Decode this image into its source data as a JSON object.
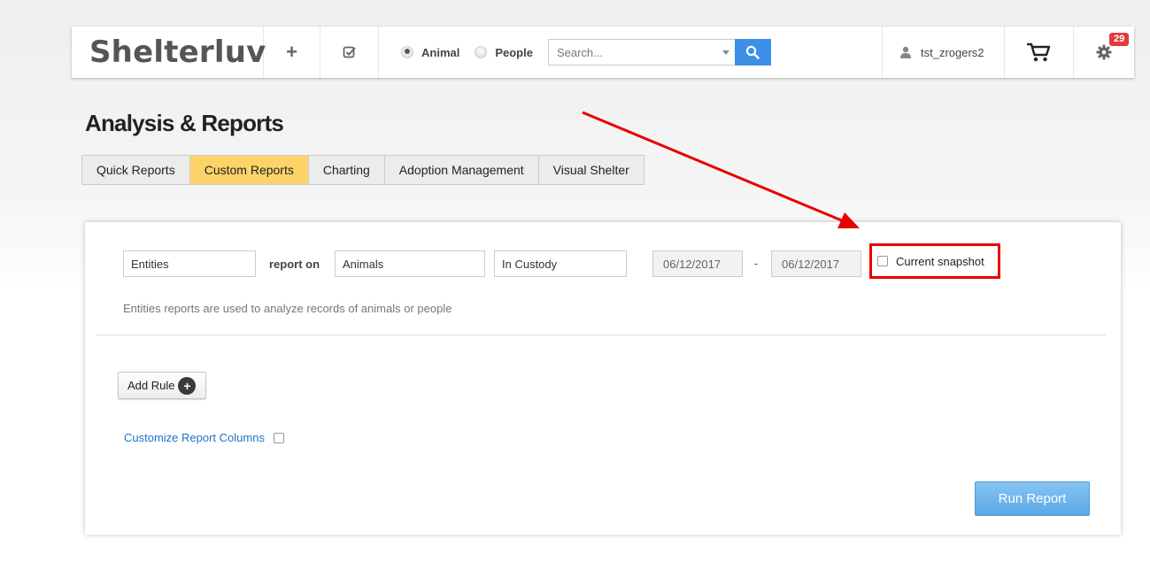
{
  "navbar": {
    "brand": "Shelterluv",
    "add_icon": "plus-icon",
    "tasks_icon": "checkbox-icon",
    "radio_options": [
      {
        "label": "Animal",
        "checked": true
      },
      {
        "label": "People",
        "checked": false
      }
    ],
    "search_placeholder": "Search...",
    "search_icon": "search-icon",
    "username": "tst_zrogers2",
    "cart_icon": "cart-icon",
    "settings_icon": "gear-icon",
    "notification_count": "29"
  },
  "page": {
    "title": "Analysis & Reports",
    "tabs": [
      {
        "label": "Quick Reports",
        "active": false
      },
      {
        "label": "Custom Reports",
        "active": true
      },
      {
        "label": "Charting",
        "active": false
      },
      {
        "label": "Adoption Management",
        "active": false
      },
      {
        "label": "Visual Shelter",
        "active": false
      }
    ]
  },
  "report": {
    "entity_type": "Entities",
    "report_on_label": "report on",
    "subject": "Animals",
    "status": "In Custody",
    "date_from": "06/12/2017",
    "date_separator": "-",
    "date_to": "06/12/2017",
    "current_snapshot_label": "Current snapshot",
    "current_snapshot_checked": false,
    "description": "Entities reports are used to analyze records of animals or people",
    "add_rule_label": "Add Rule",
    "customize_columns_label": "Customize Report Columns",
    "customize_columns_checked": false,
    "run_report_label": "Run Report"
  },
  "colors": {
    "active_tab": "#fcd469",
    "search_button": "#3d8fe8",
    "badge": "#e03c3c",
    "annotation": "#e80000",
    "link": "#1e74c7",
    "run_button": "#6fb6ee"
  }
}
